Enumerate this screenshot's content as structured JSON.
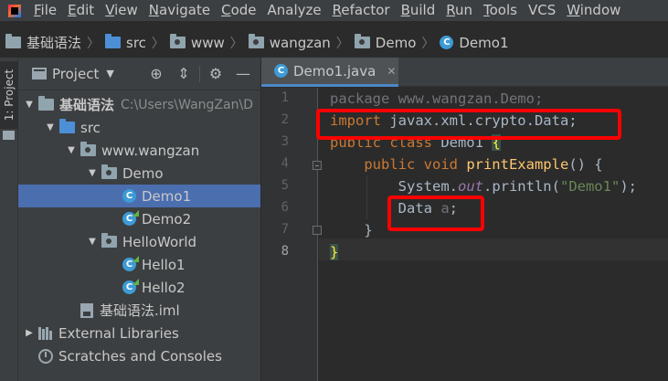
{
  "menu": {
    "items": [
      {
        "mn": "F",
        "rest": "ile"
      },
      {
        "mn": "E",
        "rest": "dit"
      },
      {
        "mn": "V",
        "rest": "iew"
      },
      {
        "mn": "N",
        "rest": "avigate"
      },
      {
        "mn": "C",
        "rest": "ode"
      },
      {
        "mn": "",
        "rest": "Analyze"
      },
      {
        "mn": "R",
        "rest": "efactor"
      },
      {
        "mn": "B",
        "rest": "uild"
      },
      {
        "mn": "R",
        "rest": "un"
      },
      {
        "mn": "T",
        "rest": "ools"
      },
      {
        "mn": "",
        "rest": "VCS"
      },
      {
        "mn": "W",
        "rest": "indow"
      }
    ]
  },
  "breadcrumb": [
    "基础语法",
    "src",
    "www",
    "wangzan",
    "Demo",
    "Demo1"
  ],
  "toolstrip": {
    "tab_label": "1: Project"
  },
  "project": {
    "title": "Project",
    "tree": [
      {
        "label": "基础语法",
        "path": "C:\\Users\\WangZan\\D",
        "depth": 0,
        "arrow": "▼",
        "icon": "folder",
        "bold": true
      },
      {
        "label": "src",
        "depth": 1,
        "arrow": "▼",
        "icon": "folder-blue"
      },
      {
        "label": "www.wangzan",
        "depth": 2,
        "arrow": "▼",
        "icon": "package"
      },
      {
        "label": "Demo",
        "depth": 3,
        "arrow": "▼",
        "icon": "package"
      },
      {
        "label": "Demo1",
        "depth": 4,
        "arrow": "",
        "icon": "class",
        "selected": true
      },
      {
        "label": "Demo2",
        "depth": 4,
        "arrow": "",
        "icon": "class-mark"
      },
      {
        "label": "HelloWorld",
        "depth": 3,
        "arrow": "▼",
        "icon": "package"
      },
      {
        "label": "Hello1",
        "depth": 4,
        "arrow": "",
        "icon": "class-mark"
      },
      {
        "label": "Hello2",
        "depth": 4,
        "arrow": "",
        "icon": "class-mark"
      },
      {
        "label": "基础语法.iml",
        "depth": 2,
        "arrow": "",
        "icon": "iml"
      },
      {
        "label": "External Libraries",
        "depth": 0,
        "arrow": "▶",
        "icon": "library"
      },
      {
        "label": "Scratches and Consoles",
        "depth": 0,
        "arrow": "",
        "icon": "scratch"
      }
    ]
  },
  "editor": {
    "tab_label": "Demo1.java",
    "line_numbers": [
      "1",
      "2",
      "3",
      "4",
      "5",
      "6",
      "7",
      "8"
    ],
    "code": {
      "l1": {
        "kw": "package",
        "rest": " www.wangzan.Demo;"
      },
      "l2": {
        "kw": "import",
        "rest": " javax.xml.crypto.Data;"
      },
      "l3": {
        "kw": "public class",
        "rest": " Demo1 ",
        "brace": "{"
      },
      "l4": {
        "indent": "    ",
        "kw": "public void",
        "fn": " printExample",
        "rest": "() {"
      },
      "l5": {
        "indent": "        ",
        "a": "System.",
        "fld": "out",
        "b": ".println(",
        "str": "\"Demo1\"",
        "c": ");"
      },
      "l6": {
        "indent": "        ",
        "type": "Data ",
        "var": "a",
        "end": ";"
      },
      "l7": {
        "indent": "    ",
        "text": "}"
      },
      "l8": {
        "brace": "}"
      }
    }
  },
  "colors": {
    "highlight_box": "#ff0000",
    "selection": "#4b6eaf"
  }
}
